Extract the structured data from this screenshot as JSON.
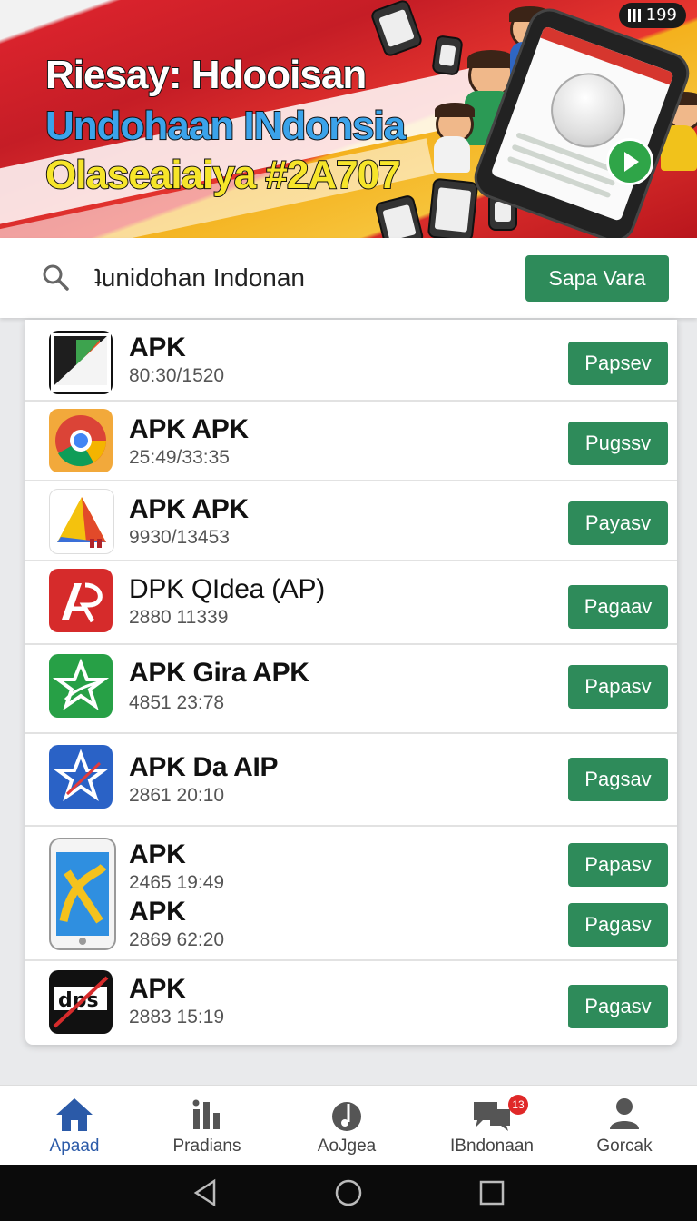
{
  "status_bar": {
    "battery": "199"
  },
  "banner": {
    "line1": "Riesay: Hdooisan",
    "line2": "Undohaan INdonsia",
    "line3": "Olaseaiaiya #2A707"
  },
  "search": {
    "value": "ʇunidohan Indonan",
    "button": "Sapa Vara"
  },
  "apps": [
    {
      "name": "APK",
      "meta": "80:30/1520",
      "button": "Papsev",
      "icon": "split-triangle-icon"
    },
    {
      "name": "APK APK",
      "meta": "25:49/33:35",
      "button": "Pugssv",
      "icon": "chrome-style-icon"
    },
    {
      "name": "APK APK",
      "meta": "9930/13453",
      "button": "Payasv",
      "icon": "tricolor-triangle-icon"
    },
    {
      "name": "DPK QIdea (AP)",
      "meta": "2880 11339",
      "button": "Pagaav",
      "icon": "red-ap-logo-icon"
    },
    {
      "name": "APK Gira APK",
      "meta": "4851 23:78",
      "button": "Papasv",
      "icon": "green-star-logo-icon"
    },
    {
      "name": "APK Da AIP",
      "meta": "2861 20:10",
      "button": "Pagsav",
      "icon": "blue-star-logo-icon"
    },
    {
      "name": "APK",
      "meta": "2465 19:49",
      "button": "Papasv",
      "icon": "phone-app-icon"
    },
    {
      "name": "APK",
      "meta": "2869 62:20",
      "button": "Pagasv",
      "icon": ""
    },
    {
      "name": "APK",
      "meta": "2883 15:19",
      "button": "Pagasv",
      "icon": "dps-logo-icon"
    }
  ],
  "bottom_nav": [
    {
      "label": "Apaad",
      "icon": "home-icon",
      "active": true
    },
    {
      "label": "Pradians",
      "icon": "bar-chart-icon",
      "active": false
    },
    {
      "label": "AoJgea",
      "icon": "music-note-icon",
      "active": false
    },
    {
      "label": "IBndonaan",
      "icon": "chat-bubbles-icon",
      "active": false,
      "badge": "13"
    },
    {
      "label": "Gorcak",
      "icon": "person-icon",
      "active": false
    }
  ],
  "colors": {
    "accent_green": "#2e8b5a",
    "active_nav": "#2b5aa8",
    "banner_red": "#d9232c"
  }
}
